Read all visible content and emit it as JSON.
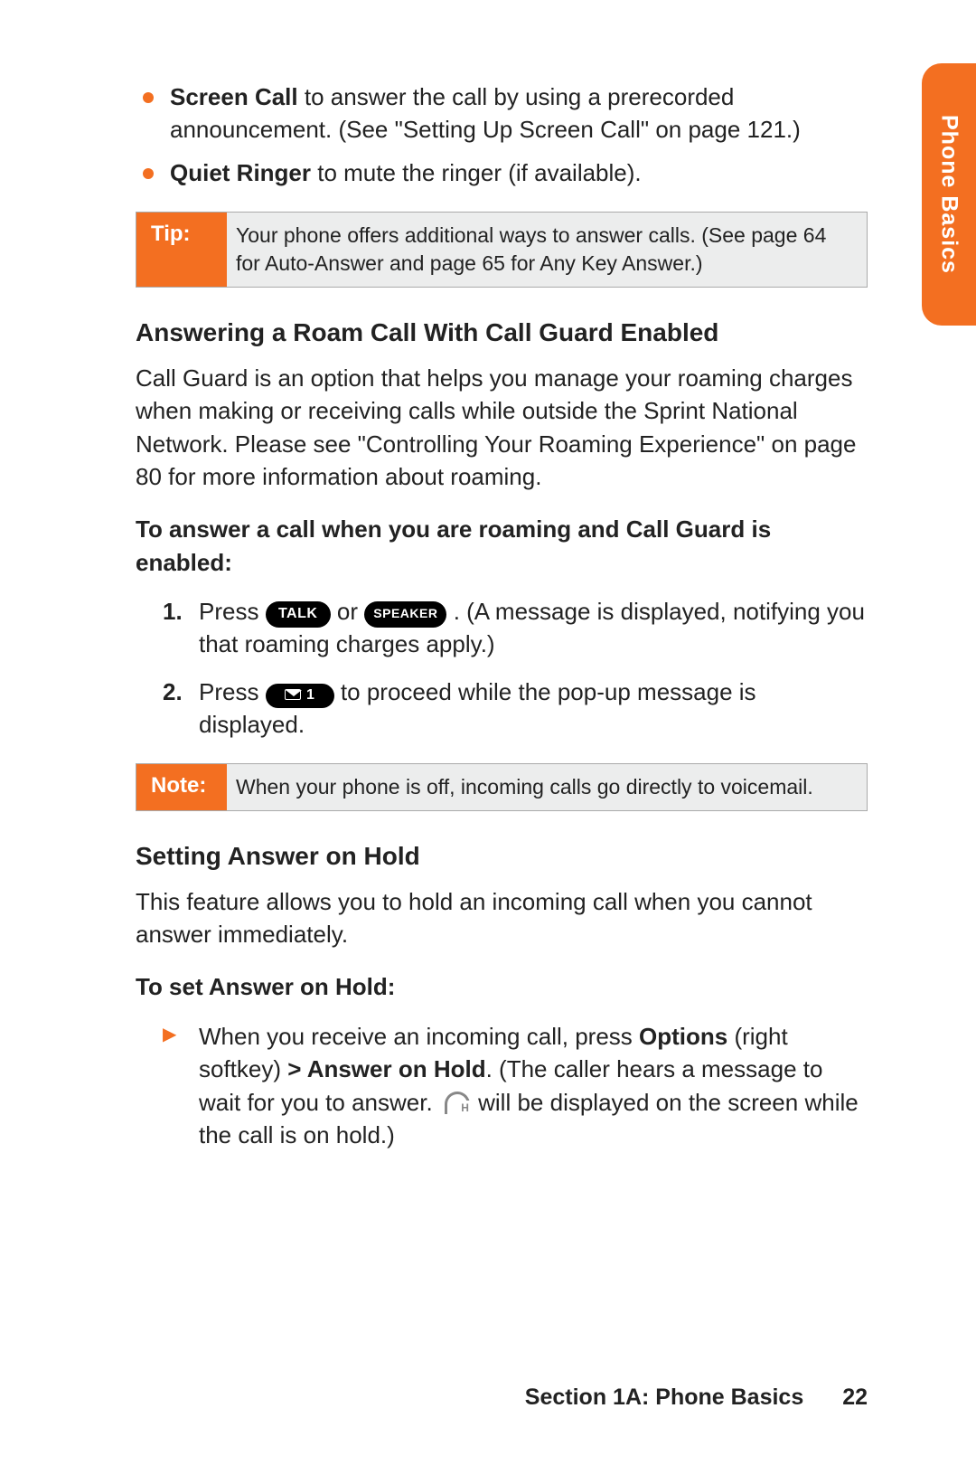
{
  "sideTab": "Phone Basics",
  "bullets": {
    "screenCall": {
      "label": "Screen Call",
      "text": " to answer the call by using a prerecorded announcement. (See \"Setting Up Screen Call\" on page 121.)"
    },
    "quietRinger": {
      "label": "Quiet Ringer",
      "text": " to mute the ringer (if available)."
    }
  },
  "tip": {
    "label": "Tip:",
    "body": "Your phone offers additional ways to answer calls. (See page 64 for Auto-Answer and page 65 for Any Key Answer.)"
  },
  "roam": {
    "heading": "Answering a Roam Call With Call Guard Enabled",
    "para": "Call Guard is an option that helps you manage your roaming charges when making or receiving calls while outside the Sprint National Network. Please see \"Controlling Your Roaming Experience\" on page 80 for more information about roaming.",
    "lead": "To answer a call when you are roaming and Call Guard is enabled:",
    "step1": {
      "pre": "Press ",
      "talk": "TALK",
      "mid": " or ",
      "speaker": "SPEAKER",
      "post": " . (A message is displayed, notifying you that roaming charges apply.)"
    },
    "step2": {
      "pre": "Press ",
      "one": "1",
      "post": " to proceed while the pop-up message is displayed."
    }
  },
  "note": {
    "label": "Note:",
    "body": "When your phone is off, incoming calls go directly to voicemail."
  },
  "hold": {
    "heading": "Setting Answer on Hold",
    "para": "This feature allows you to hold an incoming call when you cannot answer immediately.",
    "lead": "To set Answer on Hold:",
    "item": {
      "pre": "When you receive an incoming call, press ",
      "options": "Options",
      "mid1": " (right softkey) ",
      "path": "> Answer on Hold",
      "mid2": ". (The caller hears a message to wait for you to answer. ",
      "post": " will be displayed on the screen while the call is on hold.)"
    }
  },
  "footer": {
    "section": "Section 1A: Phone Basics",
    "page": "22"
  }
}
